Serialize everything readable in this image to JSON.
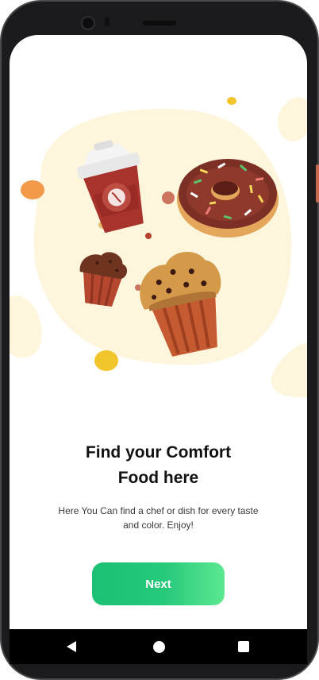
{
  "onboarding": {
    "title": "Find your  Comfort\nFood here",
    "subtitle": "Here You Can find a chef or dish for every taste and color. Enjoy!",
    "next_label": "Next"
  },
  "illustration": {
    "items": [
      "coffee-cup-icon",
      "donut-icon",
      "cupcake-icon",
      "muffin-icon"
    ]
  },
  "navigation": {
    "back_icon": "back-icon",
    "home_icon": "home-icon",
    "recents_icon": "recents-icon"
  },
  "colors": {
    "accent_start": "#1cbf73",
    "accent_end": "#5ce891",
    "blob": "#fdf5dc"
  }
}
